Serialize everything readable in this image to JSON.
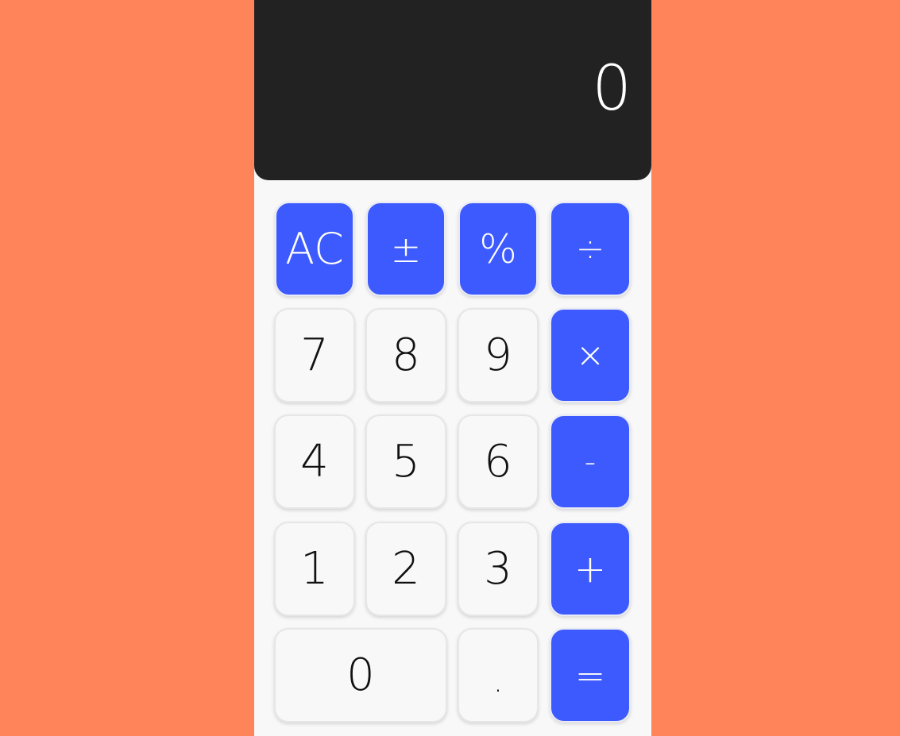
{
  "display": {
    "value": "0"
  },
  "keys": {
    "clear": "AC",
    "sign": "±",
    "percent": "%",
    "divide": "÷",
    "seven": "7",
    "eight": "8",
    "nine": "9",
    "multiply": "×",
    "four": "4",
    "five": "5",
    "six": "6",
    "subtract": "-",
    "one": "1",
    "two": "2",
    "three": "3",
    "add": "+",
    "zero": "0",
    "decimal": ".",
    "equals": "="
  },
  "colors": {
    "page_background": "#FF8459",
    "display_background": "#222222",
    "operator_key": "#3D5AFE",
    "digit_key": "#F8F8F8"
  }
}
